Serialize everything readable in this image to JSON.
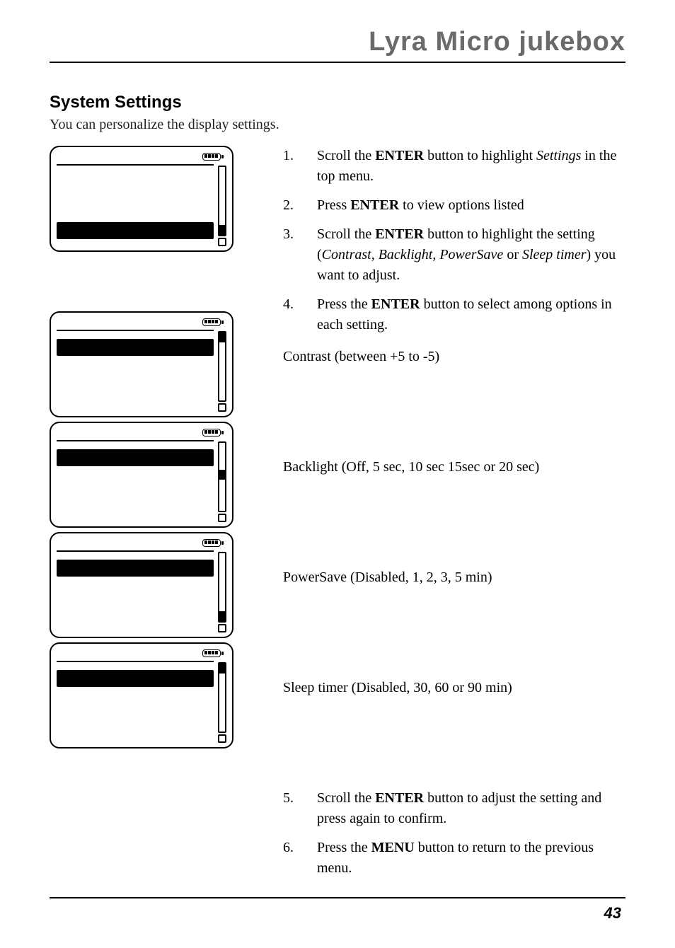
{
  "header": {
    "title": "Lyra Micro jukebox"
  },
  "section": {
    "title": "System Settings",
    "subtitle": "You can personalize the display settings."
  },
  "steps_top": [
    {
      "num": "1.",
      "html": "Scroll the <b>ENTER</b> button to highlight <i>Settings</i> in the top menu."
    },
    {
      "num": "2.",
      "html": "Press <b>ENTER</b>  to view options listed"
    },
    {
      "num": "3.",
      "html": "Scroll the <b>ENTER</b> button to highlight the setting (<i>Contrast, Backlight, PowerSave</i>  or <i>Sleep timer</i>) you want to adjust."
    },
    {
      "num": "4.",
      "html": "Press the <b>ENTER</b> button to select among options in each setting."
    }
  ],
  "options": [
    {
      "label": "Contrast (between +5 to -5)"
    },
    {
      "label": "Backlight (Off, 5 sec, 10 sec 15sec or 20 sec)"
    },
    {
      "label": "PowerSave (Disabled, 1, 2, 3, 5 min)"
    },
    {
      "label": "Sleep timer (Disabled, 30, 60 or 90 min)"
    }
  ],
  "steps_bottom": [
    {
      "num": "5.",
      "html": "Scroll the <b>ENTER</b> button to adjust the setting and press again to confirm."
    },
    {
      "num": "6.",
      "html": "Press the <b>MENU</b> button to return to the previous menu."
    }
  ],
  "devices": [
    {
      "highlightRow": 2,
      "thumbPos": "bottom"
    },
    {
      "highlightRow": 0,
      "thumbPos": "top"
    },
    {
      "highlightRow": 0,
      "thumbPos": "mid"
    },
    {
      "highlightRow": 0,
      "thumbPos": "bottom"
    },
    {
      "highlightRow": 0,
      "thumbPos": "top"
    }
  ],
  "page_number": "43"
}
